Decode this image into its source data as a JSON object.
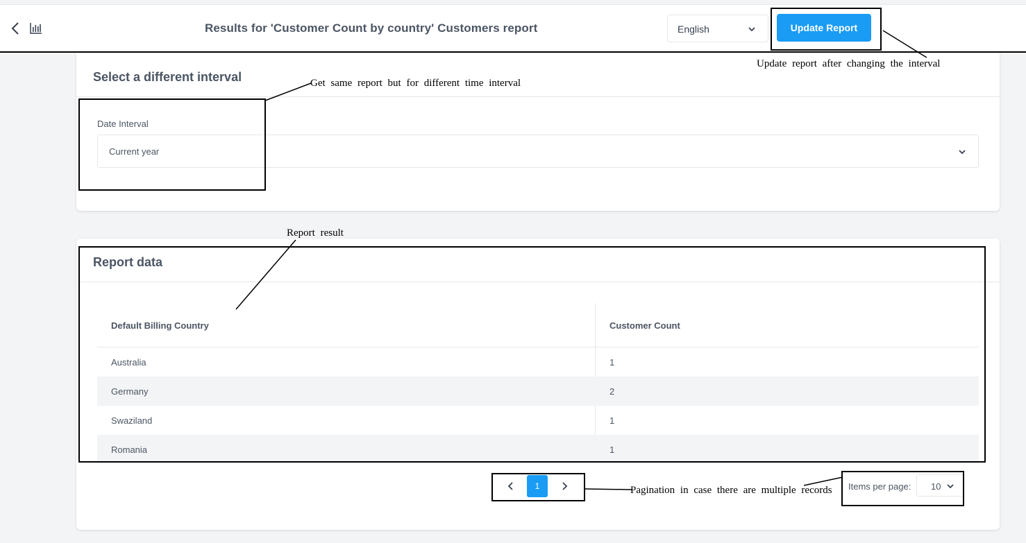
{
  "header": {
    "title": "Results for 'Customer Count by country' Customers report",
    "language": "English",
    "update_label": "Update Report"
  },
  "interval_card": {
    "title": "Select a different interval",
    "field_label": "Date Interval",
    "field_value": "Current year"
  },
  "report_card": {
    "title": "Report data",
    "columns": [
      "Default Billing Country",
      "Customer Count"
    ],
    "rows": [
      [
        "Australia",
        "1"
      ],
      [
        "Germany",
        "2"
      ],
      [
        "Swaziland",
        "1"
      ],
      [
        "Romania",
        "1"
      ]
    ]
  },
  "pagination": {
    "current_page": "1",
    "items_per_page_label": "Items per page:",
    "items_per_page": "10"
  },
  "annotations": {
    "update": "Update report after changing the interval",
    "interval": "Get same report but for different time interval",
    "result": "Report result",
    "pagination": "Pagination in case there are multiple records"
  },
  "colors": {
    "accent": "#1a9cf5",
    "background": "#f3f4f6",
    "text": "#4b5563",
    "annotation": "#000000"
  },
  "icons": [
    "chevron-left-icon",
    "bar-chart-icon",
    "chevron-down-icon",
    "chevron-right-icon"
  ]
}
